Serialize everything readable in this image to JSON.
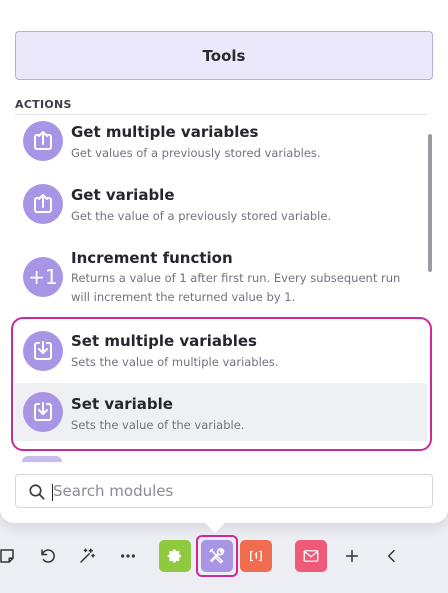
{
  "panel": {
    "title": "Tools",
    "section_label": "ACTIONS",
    "modules": [
      {
        "icon": "upload-icon",
        "title": "Get multiple variables",
        "description": "Get values of a previously stored variables."
      },
      {
        "icon": "upload-icon",
        "title": "Get variable",
        "description": "Get the value of a previously stored variable."
      },
      {
        "icon": "increment-icon",
        "icon_text": "+1",
        "title": "Increment function",
        "description": "Returns a value of 1 after first run. Every subsequent run will increment the returned value by 1."
      },
      {
        "icon": "download-icon",
        "title": "Set multiple variables",
        "description": "Sets the value of multiple variables."
      },
      {
        "icon": "download-icon",
        "title": "Set variable",
        "description": "Sets the value of the variable."
      }
    ],
    "search": {
      "placeholder": "Search modules",
      "value": ""
    }
  },
  "toolbar": {
    "items": [
      {
        "icon": "note-icon",
        "active": false
      },
      {
        "icon": "undo-icon",
        "active": false
      },
      {
        "icon": "magic-wand-icon",
        "active": false
      },
      {
        "icon": "more-icon",
        "active": false
      },
      {
        "icon": "gear-icon",
        "active": false,
        "color": "#8fc940"
      },
      {
        "icon": "tools-icon",
        "active": true,
        "color": "#a995e6"
      },
      {
        "icon": "json-icon",
        "active": false,
        "color": "#f26c4f"
      },
      {
        "icon": "email-icon",
        "active": false,
        "color": "#ef5a78"
      },
      {
        "icon": "plus-icon",
        "active": false
      },
      {
        "icon": "chevron-left-icon",
        "active": false
      }
    ]
  },
  "colors": {
    "accent": "#a995e6",
    "highlight": "#cc2a98",
    "header_bg": "#ece8fb"
  }
}
